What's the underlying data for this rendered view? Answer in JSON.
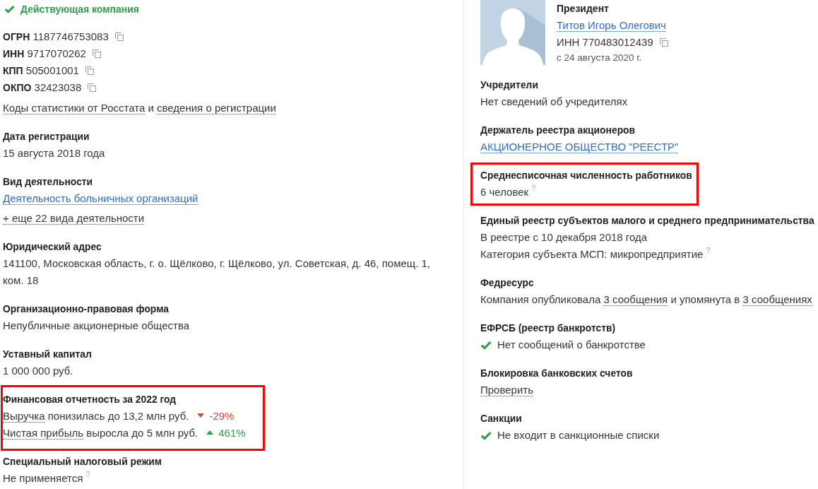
{
  "left_column": {
    "status": {
      "text": "Действующая компания"
    },
    "identifiers": [
      {
        "label": "ОГРН",
        "value": "1187746753083"
      },
      {
        "label": "ИНН",
        "value": "9717070262"
      },
      {
        "label": "КПП",
        "value": "505001001"
      },
      {
        "label": "ОКПО",
        "value": "32423038"
      }
    ],
    "registry_links": {
      "parts": [
        {
          "kind": "dotted",
          "text": "Коды статистики от Росстата"
        },
        {
          "kind": "text",
          "text": "и"
        },
        {
          "kind": "dotted",
          "text": "сведения о регистрации"
        }
      ]
    },
    "sections": [
      {
        "title": "Дата регистрации",
        "highlighted": false,
        "lines": [
          {
            "check": false,
            "parts": [
              {
                "kind": "text",
                "text": "15 августа 2018 года"
              }
            ]
          }
        ]
      },
      {
        "title": "Вид деятельности",
        "highlighted": false,
        "lines": [
          {
            "check": false,
            "parts": [
              {
                "kind": "link",
                "text": "Деятельность больничных организаций"
              }
            ]
          },
          {
            "check": false,
            "parts": [
              {
                "kind": "dotted",
                "text": "+ еще 22 вида деятельности"
              }
            ]
          }
        ]
      },
      {
        "title": "Юридический адрес",
        "highlighted": false,
        "lines": [
          {
            "check": false,
            "parts": [
              {
                "kind": "text",
                "text": "141100, Московская область, г. о. Щёлково, г. Щёлково, ул. Советская, д. 46, помещ. 1, ком. 18"
              }
            ]
          }
        ]
      },
      {
        "title": "Организационно-правовая форма",
        "highlighted": false,
        "lines": [
          {
            "check": false,
            "parts": [
              {
                "kind": "text",
                "text": "Непубличные акционерные общества"
              }
            ]
          }
        ]
      },
      {
        "title": "Уставный капитал",
        "highlighted": false,
        "lines": [
          {
            "check": false,
            "parts": [
              {
                "kind": "text",
                "text": "1 000 000 руб."
              }
            ]
          }
        ]
      },
      {
        "title": "Финансовая отчетность за 2022 год",
        "highlighted": true,
        "lines": [
          {
            "check": false,
            "parts": [
              {
                "kind": "dotted",
                "text": "Выручка"
              },
              {
                "kind": "text",
                "text": "понизилась до 13,2 млн руб."
              }
            ],
            "trend": {
              "rising": false,
              "text": "-29%",
              "color": "#d9472b"
            }
          },
          {
            "check": false,
            "parts": [
              {
                "kind": "dotted",
                "text": "Чистая прибыль"
              },
              {
                "kind": "text",
                "text": "выросла до 5 млн руб."
              }
            ],
            "trend": {
              "rising": true,
              "text": "461%",
              "color": "#2e9e48"
            }
          }
        ]
      },
      {
        "title": "Специальный налоговый режим",
        "highlighted": false,
        "lines": [
          {
            "check": false,
            "parts": [
              {
                "kind": "text",
                "text": "Не применяется"
              }
            ],
            "hint": "?"
          }
        ]
      }
    ]
  },
  "right_column": {
    "director": {
      "role": "Президент",
      "name": "Титов Игорь Олегович",
      "inn": "ИНН 770483012439",
      "since": "с 24 августа 2020 г."
    },
    "sections": [
      {
        "title": "Учредители",
        "highlighted": false,
        "lines": [
          {
            "check": false,
            "parts": [
              {
                "kind": "text",
                "text": "Нет сведений об учредителях"
              }
            ]
          }
        ]
      },
      {
        "title": "Держатель реестра акционеров",
        "highlighted": false,
        "lines": [
          {
            "check": false,
            "parts": [
              {
                "kind": "link",
                "text": "АКЦИОНЕРНОЕ ОБЩЕСТВО \"РЕЕСТР\""
              }
            ]
          }
        ]
      },
      {
        "title": "Среднесписочная численность работников",
        "highlighted": true,
        "lines": [
          {
            "check": false,
            "parts": [
              {
                "kind": "text",
                "text": "6 человек"
              }
            ],
            "hint": "?"
          }
        ]
      },
      {
        "title": "Единый реестр субъектов малого и среднего предпринимательства",
        "highlighted": false,
        "lines": [
          {
            "check": false,
            "parts": [
              {
                "kind": "text",
                "text": "В реестре с 10 декабря 2018 года"
              }
            ]
          },
          {
            "check": false,
            "parts": [
              {
                "kind": "text",
                "text": "Категория субъекта МСП: микропредприятие"
              }
            ],
            "hint": "?"
          }
        ]
      },
      {
        "title": "Федресурс",
        "highlighted": false,
        "lines": [
          {
            "check": false,
            "parts": [
              {
                "kind": "text",
                "text": "Компания опубликовала"
              },
              {
                "kind": "dotted",
                "text": "3 сообщения"
              },
              {
                "kind": "text",
                "text": "и упомянута в"
              },
              {
                "kind": "dotted",
                "text": "3 сообщениях"
              }
            ]
          }
        ]
      },
      {
        "title": "ЕФРСБ (реестр банкротств)",
        "highlighted": false,
        "lines": [
          {
            "check": true,
            "parts": [
              {
                "kind": "text",
                "text": "Нет сообщений о банкротстве"
              }
            ]
          }
        ]
      },
      {
        "title": "Блокировка банковских счетов",
        "highlighted": false,
        "lines": [
          {
            "check": false,
            "parts": [
              {
                "kind": "dotted",
                "text": "Проверить"
              }
            ]
          }
        ]
      },
      {
        "title": "Санкции",
        "highlighted": false,
        "lines": [
          {
            "check": true,
            "parts": [
              {
                "kind": "text",
                "text": "Не входит в санкционные списки"
              }
            ]
          }
        ]
      }
    ]
  }
}
